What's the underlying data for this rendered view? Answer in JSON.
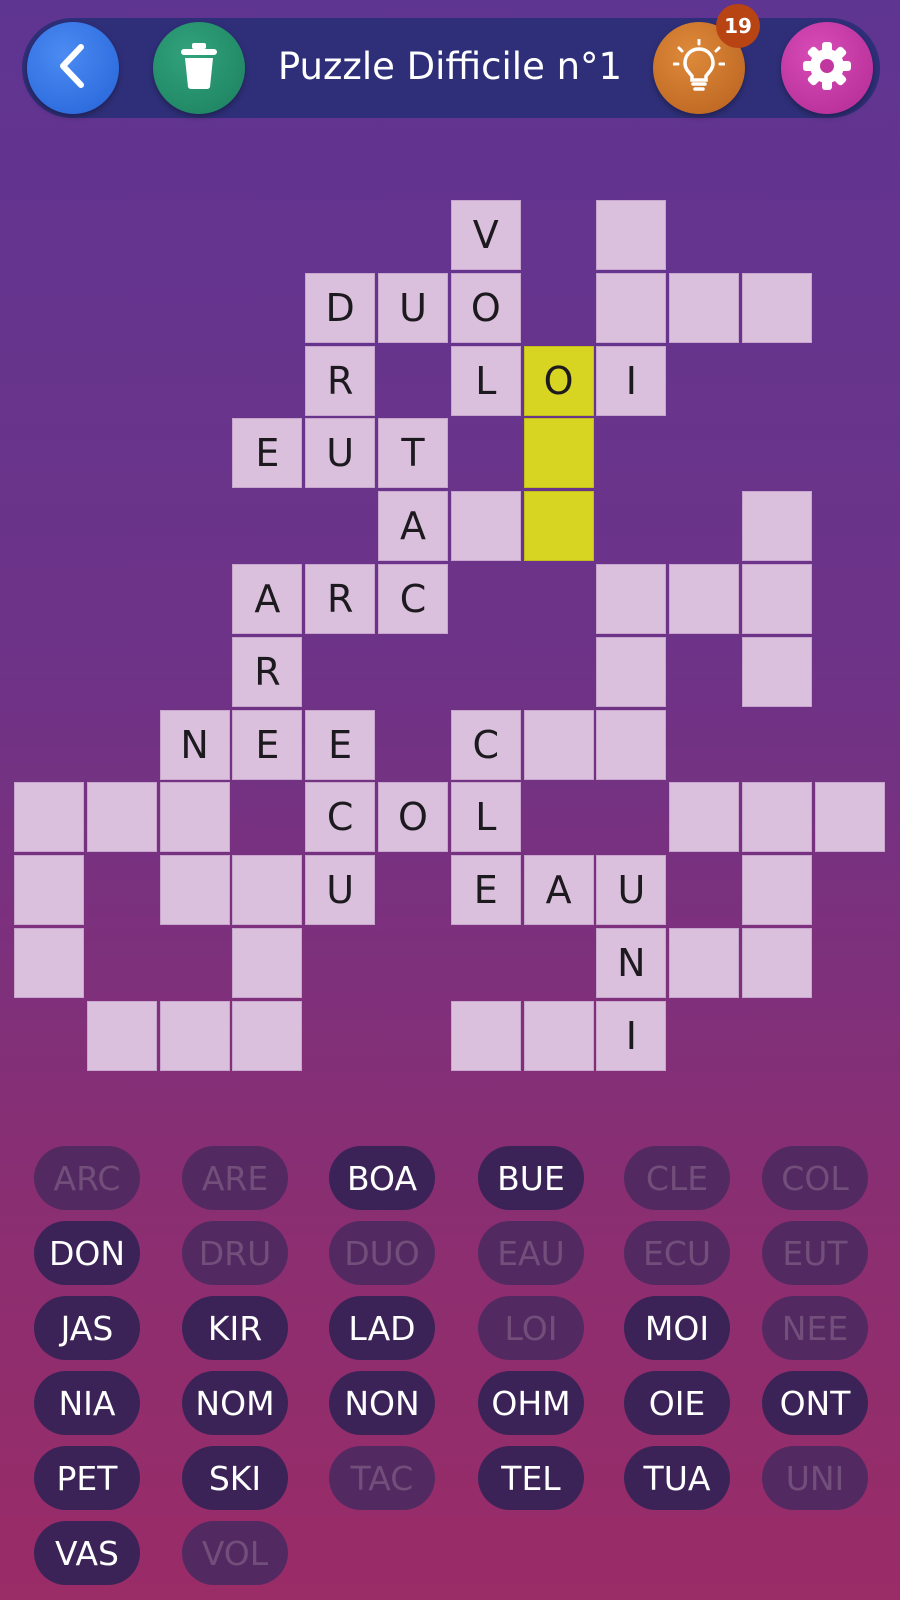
{
  "header": {
    "title": "Puzzle Difficile n°1",
    "hint_count": "19",
    "icons": {
      "back": "chevron-left-icon",
      "trash": "trash-icon",
      "hint": "lightbulb-icon",
      "settings": "gear-icon"
    }
  },
  "colors": {
    "cell": "#dbc0dd",
    "highlight": "#d7d422",
    "pill": "#3b2357",
    "pill_used_text": "#724e7a"
  },
  "grid": [
    {
      "r": 0,
      "c": 6,
      "l": "V"
    },
    {
      "r": 0,
      "c": 8,
      "l": ""
    },
    {
      "r": 1,
      "c": 4,
      "l": "D"
    },
    {
      "r": 1,
      "c": 5,
      "l": "U"
    },
    {
      "r": 1,
      "c": 6,
      "l": "O"
    },
    {
      "r": 1,
      "c": 8,
      "l": ""
    },
    {
      "r": 1,
      "c": 9,
      "l": ""
    },
    {
      "r": 1,
      "c": 10,
      "l": ""
    },
    {
      "r": 2,
      "c": 4,
      "l": "R"
    },
    {
      "r": 2,
      "c": 6,
      "l": "L"
    },
    {
      "r": 2,
      "c": 7,
      "l": "O",
      "hl": true
    },
    {
      "r": 2,
      "c": 8,
      "l": "I"
    },
    {
      "r": 3,
      "c": 3,
      "l": "E"
    },
    {
      "r": 3,
      "c": 4,
      "l": "U"
    },
    {
      "r": 3,
      "c": 5,
      "l": "T"
    },
    {
      "r": 3,
      "c": 7,
      "l": "",
      "hl": true
    },
    {
      "r": 4,
      "c": 5,
      "l": "A"
    },
    {
      "r": 4,
      "c": 6,
      "l": ""
    },
    {
      "r": 4,
      "c": 7,
      "l": "",
      "hl": true
    },
    {
      "r": 4,
      "c": 10,
      "l": ""
    },
    {
      "r": 5,
      "c": 3,
      "l": "A"
    },
    {
      "r": 5,
      "c": 4,
      "l": "R"
    },
    {
      "r": 5,
      "c": 5,
      "l": "C"
    },
    {
      "r": 5,
      "c": 8,
      "l": ""
    },
    {
      "r": 5,
      "c": 9,
      "l": ""
    },
    {
      "r": 5,
      "c": 10,
      "l": ""
    },
    {
      "r": 6,
      "c": 3,
      "l": "R"
    },
    {
      "r": 6,
      "c": 8,
      "l": ""
    },
    {
      "r": 6,
      "c": 10,
      "l": ""
    },
    {
      "r": 7,
      "c": 2,
      "l": "N"
    },
    {
      "r": 7,
      "c": 3,
      "l": "E"
    },
    {
      "r": 7,
      "c": 4,
      "l": "E"
    },
    {
      "r": 7,
      "c": 6,
      "l": "C"
    },
    {
      "r": 7,
      "c": 7,
      "l": ""
    },
    {
      "r": 7,
      "c": 8,
      "l": ""
    },
    {
      "r": 8,
      "c": 0,
      "l": ""
    },
    {
      "r": 8,
      "c": 1,
      "l": ""
    },
    {
      "r": 8,
      "c": 2,
      "l": ""
    },
    {
      "r": 8,
      "c": 4,
      "l": "C"
    },
    {
      "r": 8,
      "c": 5,
      "l": "O"
    },
    {
      "r": 8,
      "c": 6,
      "l": "L"
    },
    {
      "r": 8,
      "c": 9,
      "l": ""
    },
    {
      "r": 8,
      "c": 10,
      "l": ""
    },
    {
      "r": 8,
      "c": 11,
      "l": ""
    },
    {
      "r": 9,
      "c": 0,
      "l": ""
    },
    {
      "r": 9,
      "c": 2,
      "l": ""
    },
    {
      "r": 9,
      "c": 3,
      "l": ""
    },
    {
      "r": 9,
      "c": 4,
      "l": "U"
    },
    {
      "r": 9,
      "c": 6,
      "l": "E"
    },
    {
      "r": 9,
      "c": 7,
      "l": "A"
    },
    {
      "r": 9,
      "c": 8,
      "l": "U"
    },
    {
      "r": 9,
      "c": 10,
      "l": ""
    },
    {
      "r": 10,
      "c": 0,
      "l": ""
    },
    {
      "r": 10,
      "c": 3,
      "l": ""
    },
    {
      "r": 10,
      "c": 8,
      "l": "N"
    },
    {
      "r": 10,
      "c": 9,
      "l": ""
    },
    {
      "r": 10,
      "c": 10,
      "l": ""
    },
    {
      "r": 11,
      "c": 1,
      "l": ""
    },
    {
      "r": 11,
      "c": 2,
      "l": ""
    },
    {
      "r": 11,
      "c": 3,
      "l": ""
    },
    {
      "r": 11,
      "c": 6,
      "l": ""
    },
    {
      "r": 11,
      "c": 7,
      "l": ""
    },
    {
      "r": 11,
      "c": 8,
      "l": "I"
    }
  ],
  "words": [
    {
      "w": "ARC",
      "used": true
    },
    {
      "w": "ARE",
      "used": true
    },
    {
      "w": "BOA",
      "used": false
    },
    {
      "w": "BUE",
      "used": false
    },
    {
      "w": "CLE",
      "used": true
    },
    {
      "w": "COL",
      "used": true
    },
    {
      "w": "DON",
      "used": false
    },
    {
      "w": "DRU",
      "used": true
    },
    {
      "w": "DUO",
      "used": true
    },
    {
      "w": "EAU",
      "used": true
    },
    {
      "w": "ECU",
      "used": true
    },
    {
      "w": "EUT",
      "used": true
    },
    {
      "w": "JAS",
      "used": false
    },
    {
      "w": "KIR",
      "used": false
    },
    {
      "w": "LAD",
      "used": false
    },
    {
      "w": "LOI",
      "used": true
    },
    {
      "w": "MOI",
      "used": false
    },
    {
      "w": "NEE",
      "used": true
    },
    {
      "w": "NIA",
      "used": false
    },
    {
      "w": "NOM",
      "used": false
    },
    {
      "w": "NON",
      "used": false
    },
    {
      "w": "OHM",
      "used": false
    },
    {
      "w": "OIE",
      "used": false
    },
    {
      "w": "ONT",
      "used": false
    },
    {
      "w": "PET",
      "used": false
    },
    {
      "w": "SKI",
      "used": false
    },
    {
      "w": "TAC",
      "used": true
    },
    {
      "w": "TEL",
      "used": false
    },
    {
      "w": "TUA",
      "used": false
    },
    {
      "w": "UNI",
      "used": true
    },
    {
      "w": "VAS",
      "used": false
    },
    {
      "w": "VOL",
      "used": true
    }
  ]
}
